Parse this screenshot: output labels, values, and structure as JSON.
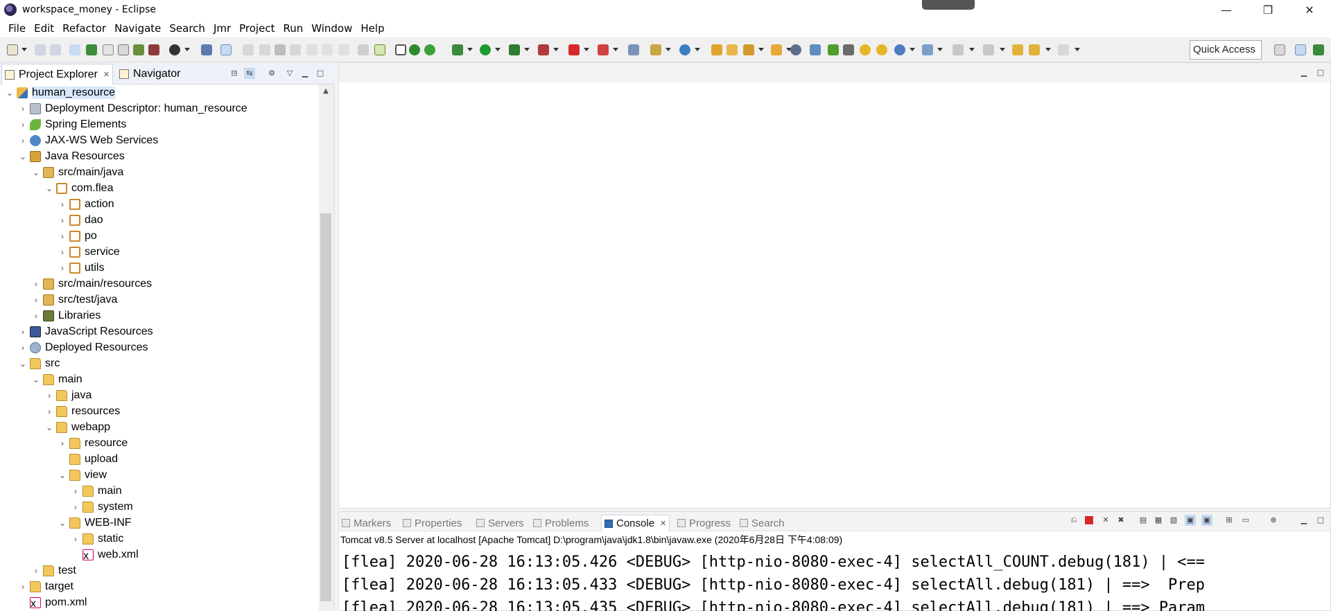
{
  "window": {
    "title": "workspace_money - Eclipse"
  },
  "window_controls": [
    "—",
    "❐",
    "✕"
  ],
  "menu": [
    "File",
    "Edit",
    "Refactor",
    "Navigate",
    "Search",
    "Jmr",
    "Project",
    "Run",
    "Window",
    "Help"
  ],
  "toolbar": {
    "quick_access": "Quick Access"
  },
  "left_views": {
    "tabs": [
      {
        "label": "Project Explorer",
        "active": true
      },
      {
        "label": "Navigator",
        "active": false
      }
    ]
  },
  "tree": [
    {
      "label": "human_resource",
      "depth": 0,
      "twisty": "open",
      "icon": "project",
      "selected": true
    },
    {
      "label": "Deployment Descriptor: human_resource",
      "depth": 1,
      "twisty": "closed",
      "icon": "gear"
    },
    {
      "label": "Spring Elements",
      "depth": 1,
      "twisty": "closed",
      "icon": "spring"
    },
    {
      "label": "JAX-WS Web Services",
      "depth": 1,
      "twisty": "closed",
      "icon": "ws"
    },
    {
      "label": "Java Resources",
      "depth": 1,
      "twisty": "open",
      "icon": "javares"
    },
    {
      "label": "src/main/java",
      "depth": 2,
      "twisty": "open",
      "icon": "srcfolder"
    },
    {
      "label": "com.flea",
      "depth": 3,
      "twisty": "open",
      "icon": "package"
    },
    {
      "label": "action",
      "depth": 4,
      "twisty": "closed",
      "icon": "package"
    },
    {
      "label": "dao",
      "depth": 4,
      "twisty": "closed",
      "icon": "package"
    },
    {
      "label": "po",
      "depth": 4,
      "twisty": "closed",
      "icon": "package"
    },
    {
      "label": "service",
      "depth": 4,
      "twisty": "closed",
      "icon": "package"
    },
    {
      "label": "utils",
      "depth": 4,
      "twisty": "closed",
      "icon": "package"
    },
    {
      "label": "src/main/resources",
      "depth": 2,
      "twisty": "closed",
      "icon": "srcfolder"
    },
    {
      "label": "src/test/java",
      "depth": 2,
      "twisty": "closed",
      "icon": "srcfolder"
    },
    {
      "label": "Libraries",
      "depth": 2,
      "twisty": "closed",
      "icon": "lib"
    },
    {
      "label": "JavaScript Resources",
      "depth": 1,
      "twisty": "closed",
      "icon": "jsres"
    },
    {
      "label": "Deployed Resources",
      "depth": 1,
      "twisty": "closed",
      "icon": "deployed"
    },
    {
      "label": "src",
      "depth": 1,
      "twisty": "open",
      "icon": "folder"
    },
    {
      "label": "main",
      "depth": 2,
      "twisty": "open",
      "icon": "folder"
    },
    {
      "label": "java",
      "depth": 3,
      "twisty": "closed",
      "icon": "folder"
    },
    {
      "label": "resources",
      "depth": 3,
      "twisty": "closed",
      "icon": "folder"
    },
    {
      "label": "webapp",
      "depth": 3,
      "twisty": "open",
      "icon": "folder"
    },
    {
      "label": "resource",
      "depth": 4,
      "twisty": "closed",
      "icon": "folder"
    },
    {
      "label": "upload",
      "depth": 4,
      "twisty": "none",
      "icon": "folder"
    },
    {
      "label": "view",
      "depth": 4,
      "twisty": "open",
      "icon": "folder"
    },
    {
      "label": "main",
      "depth": 5,
      "twisty": "closed",
      "icon": "folder"
    },
    {
      "label": "system",
      "depth": 5,
      "twisty": "closed",
      "icon": "folder"
    },
    {
      "label": "WEB-INF",
      "depth": 4,
      "twisty": "open",
      "icon": "folder"
    },
    {
      "label": "static",
      "depth": 5,
      "twisty": "closed",
      "icon": "folder"
    },
    {
      "label": "web.xml",
      "depth": 5,
      "twisty": "none",
      "icon": "xml"
    },
    {
      "label": "test",
      "depth": 2,
      "twisty": "closed",
      "icon": "folder"
    },
    {
      "label": "target",
      "depth": 1,
      "twisty": "closed",
      "icon": "folder"
    },
    {
      "label": "pom.xml",
      "depth": 1,
      "twisty": "none",
      "icon": "xml"
    }
  ],
  "bottom_views": {
    "tabs": [
      {
        "label": "Markers",
        "active": false
      },
      {
        "label": "Properties",
        "active": false
      },
      {
        "label": "Servers",
        "active": false
      },
      {
        "label": "Problems",
        "active": false
      },
      {
        "label": "Console",
        "active": true
      },
      {
        "label": "Progress",
        "active": false
      },
      {
        "label": "Search",
        "active": false
      }
    ]
  },
  "console": {
    "header": "Tomcat v8.5 Server at localhost [Apache Tomcat] D:\\program\\java\\jdk1.8\\bin\\javaw.exe (2020年6月28日 下午4:08:09)",
    "lines": [
      "[flea] 2020-06-28 16:13:05.426 <DEBUG> [http-nio-8080-exec-4] selectAll_COUNT.debug(181) | <==",
      "[flea] 2020-06-28 16:13:05.433 <DEBUG> [http-nio-8080-exec-4] selectAll.debug(181) | ==>  Prep",
      "[flea] 2020-06-28 16:13:05.435 <DEBUG> [http-nio-8080-exec-4] selectAll.debug(181) | ==> Param"
    ]
  }
}
